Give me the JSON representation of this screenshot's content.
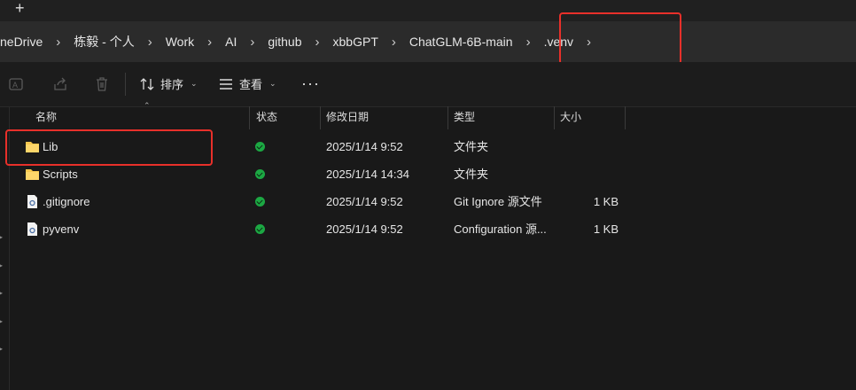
{
  "tabs": {
    "new_tab_symbol": "+"
  },
  "breadcrumb": {
    "items": [
      "neDrive",
      "栋毅 - 个人",
      "Work",
      "AI",
      "github",
      "xbbGPT",
      "ChatGLM-6B-main",
      ".venv"
    ],
    "separator": "›"
  },
  "toolbar": {
    "sort_label": "排序",
    "view_label": "查看",
    "more_label": "···",
    "icons": [
      "rename-icon",
      "share-icon",
      "delete-icon",
      "sort-icon",
      "view-icon",
      "more-icon"
    ]
  },
  "columns": {
    "name": "名称",
    "status": "状态",
    "modified": "修改日期",
    "type": "类型",
    "size": "大小"
  },
  "files": [
    {
      "name": "Lib",
      "icon": "folder-icon",
      "status": "synced",
      "modified": "2025/1/14 9:52",
      "type": "文件夹",
      "size": ""
    },
    {
      "name": "Scripts",
      "icon": "folder-icon",
      "status": "synced",
      "modified": "2025/1/14 14:34",
      "type": "文件夹",
      "size": ""
    },
    {
      "name": ".gitignore",
      "icon": "file-icon",
      "status": "synced",
      "modified": "2025/1/14 9:52",
      "type": "Git Ignore 源文件",
      "size": "1 KB"
    },
    {
      "name": "pyvenv",
      "icon": "file-icon",
      "status": "synced",
      "modified": "2025/1/14 9:52",
      "type": "Configuration 源...",
      "size": "1 KB"
    }
  ],
  "colors": {
    "accent_highlight": "#e8302a",
    "status_green": "#1ca843",
    "folder": "#f6c74e"
  }
}
